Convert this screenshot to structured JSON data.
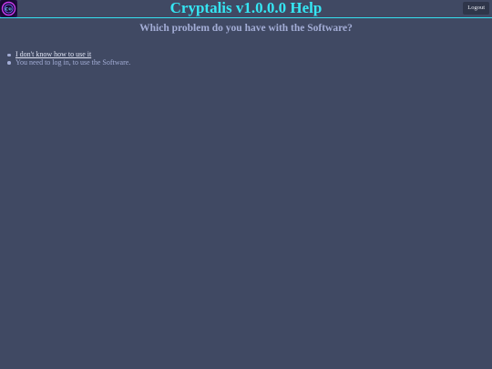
{
  "header": {
    "title": "Cryptalis v1.0.0.0 Help",
    "logo_icon": "cryptalis-logo-icon",
    "logout_label": "Logout"
  },
  "main": {
    "question": "Which problem do you have with the Software?",
    "problems": [
      {
        "label": "I don't know how to use it",
        "link": true
      },
      {
        "label": "You need to log in, to use the Software.",
        "link": false
      }
    ]
  },
  "colors": {
    "background": "#404963",
    "title": "#35e6f3",
    "accent_line": "#35e0f0",
    "text_muted": "#a3add6",
    "link": "#dfe3f3",
    "button_bg": "#2f364a"
  }
}
